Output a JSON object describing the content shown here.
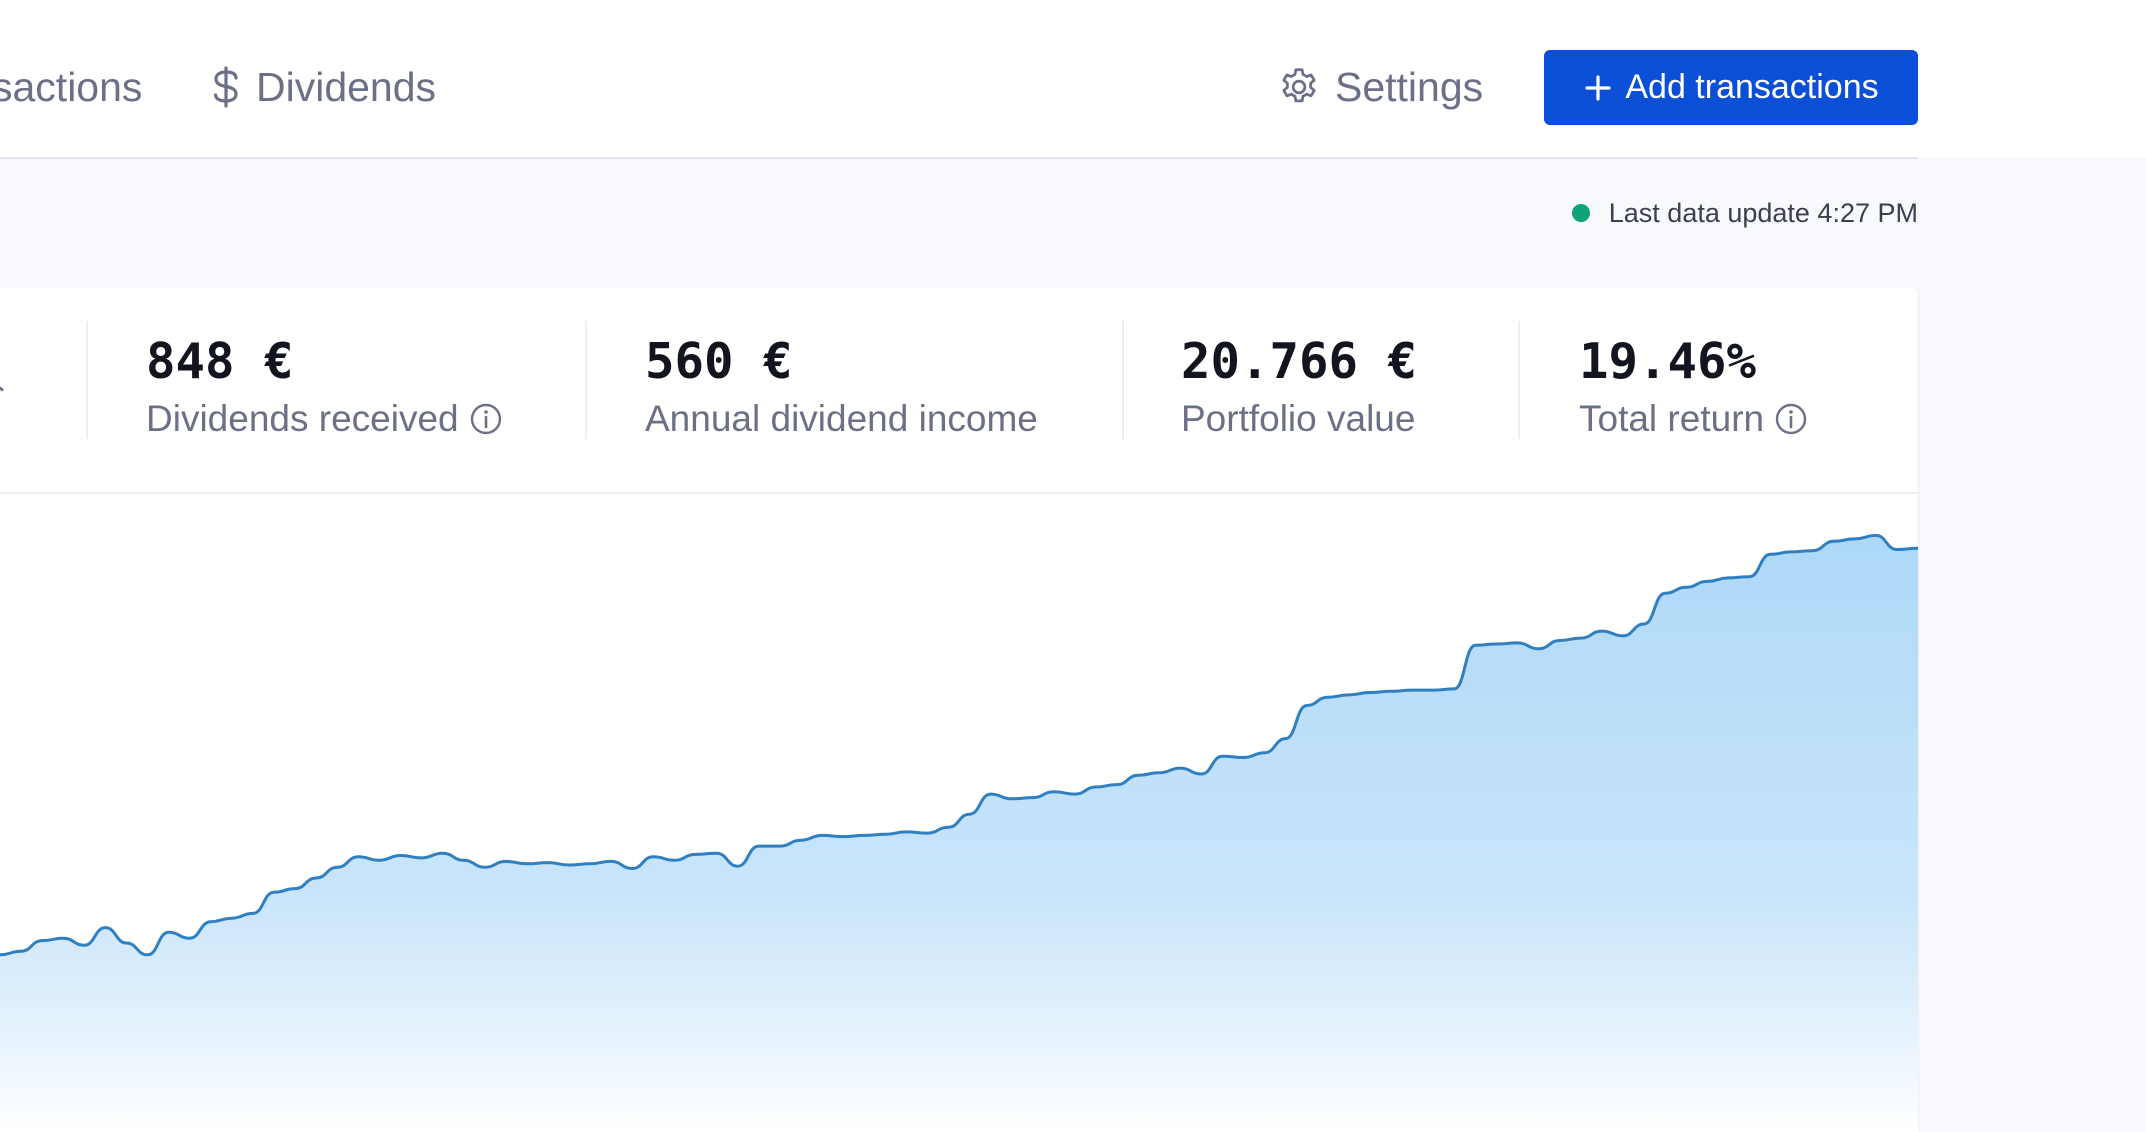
{
  "nav": {
    "transactions_label": "sactions",
    "dividends_label": "Dividends",
    "settings_label": "Settings"
  },
  "actions": {
    "add_transactions_label": "Add transactions"
  },
  "status": {
    "last_update_text": "Last data update 4:27 PM",
    "dot_color": "#10a37a"
  },
  "stats": [
    {
      "value": "848 €",
      "label": "Dividends received",
      "has_info": true
    },
    {
      "value": "560 €",
      "label": "Annual dividend income",
      "has_info": false
    },
    {
      "value": "20.766 €",
      "label": "Portfolio value",
      "has_info": false
    },
    {
      "value": "19.46%",
      "label": "Total return",
      "has_info": true
    }
  ],
  "colors": {
    "accent": "#0a4fd6",
    "line": "#2f7fc1",
    "fill_top": "#a9d6f7",
    "text_muted": "#6b7086",
    "text_strong": "#121420"
  },
  "chart_data": {
    "type": "area",
    "y": [
      15,
      15.3,
      16.2,
      16.4,
      15.8,
      17.3,
      16,
      15,
      16.9,
      16.4,
      17.8,
      18.1,
      18.5,
      20.3,
      20.6,
      21.5,
      22.4,
      23.3,
      23,
      23.4,
      23.2,
      23.6,
      23,
      22.4,
      22.9,
      22.7,
      22.8,
      22.6,
      22.7,
      22.9,
      22.3,
      23.3,
      23,
      23.5,
      23.6,
      22.5,
      24.2,
      24.2,
      24.7,
      25.1,
      25,
      25.1,
      25.2,
      25.4,
      25.3,
      25.8,
      26.9,
      28.6,
      28.2,
      28.3,
      28.8,
      28.6,
      29.2,
      29.4,
      30.2,
      30.4,
      30.8,
      30.3,
      31.8,
      31.7,
      32.1,
      33.3,
      36.1,
      36.8,
      37,
      37.2,
      37.3,
      37.4,
      37.4,
      37.5,
      41.2,
      41.3,
      41.4,
      40.9,
      41.6,
      41.8,
      42.4,
      42,
      43,
      45.6,
      46.1,
      46.6,
      46.9,
      47,
      48.9,
      49.1,
      49.2,
      50,
      50.2,
      50.5,
      49.3,
      49.4
    ],
    "ylim": [
      0,
      54
    ],
    "series": [
      {
        "values_ref": "y"
      }
    ]
  }
}
